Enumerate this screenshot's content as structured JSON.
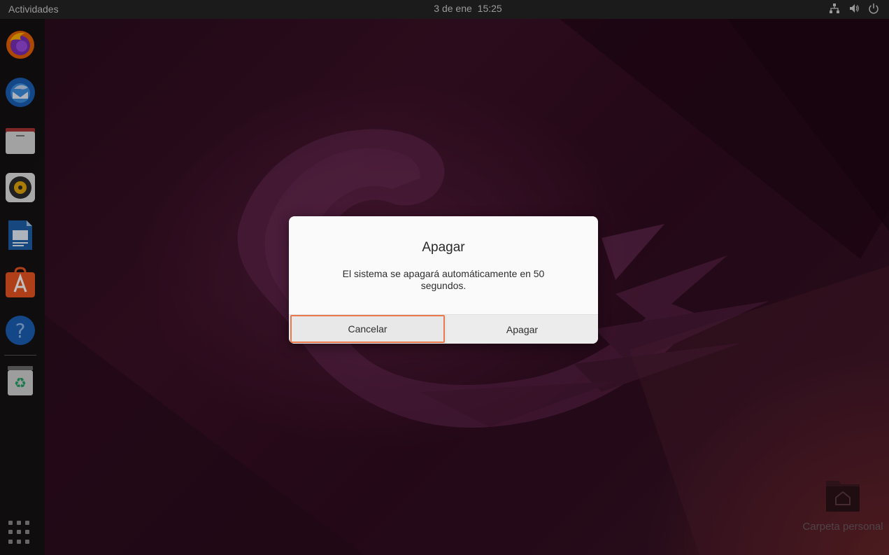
{
  "topbar": {
    "activities": "Actividades",
    "date": "3 de ene",
    "time": "15:25",
    "tray_icons": [
      "network-icon",
      "volume-icon",
      "power-icon"
    ]
  },
  "dock": {
    "apps": [
      {
        "name": "firefox-icon"
      },
      {
        "name": "thunderbird-icon"
      },
      {
        "name": "files-icon"
      },
      {
        "name": "rhythmbox-icon"
      },
      {
        "name": "writer-icon"
      },
      {
        "name": "software-icon"
      },
      {
        "name": "help-icon"
      },
      {
        "name": "trash-icon"
      }
    ],
    "show_apps_icon": "apps-grid-icon"
  },
  "desktop": {
    "home_folder_label": "Carpeta personal"
  },
  "dialog": {
    "title": "Apagar",
    "message": "El sistema se apagará automáticamente en 50 segundos.",
    "cancel_label": "Cancelar",
    "confirm_label": "Apagar",
    "focus_color": "#e9794d"
  }
}
